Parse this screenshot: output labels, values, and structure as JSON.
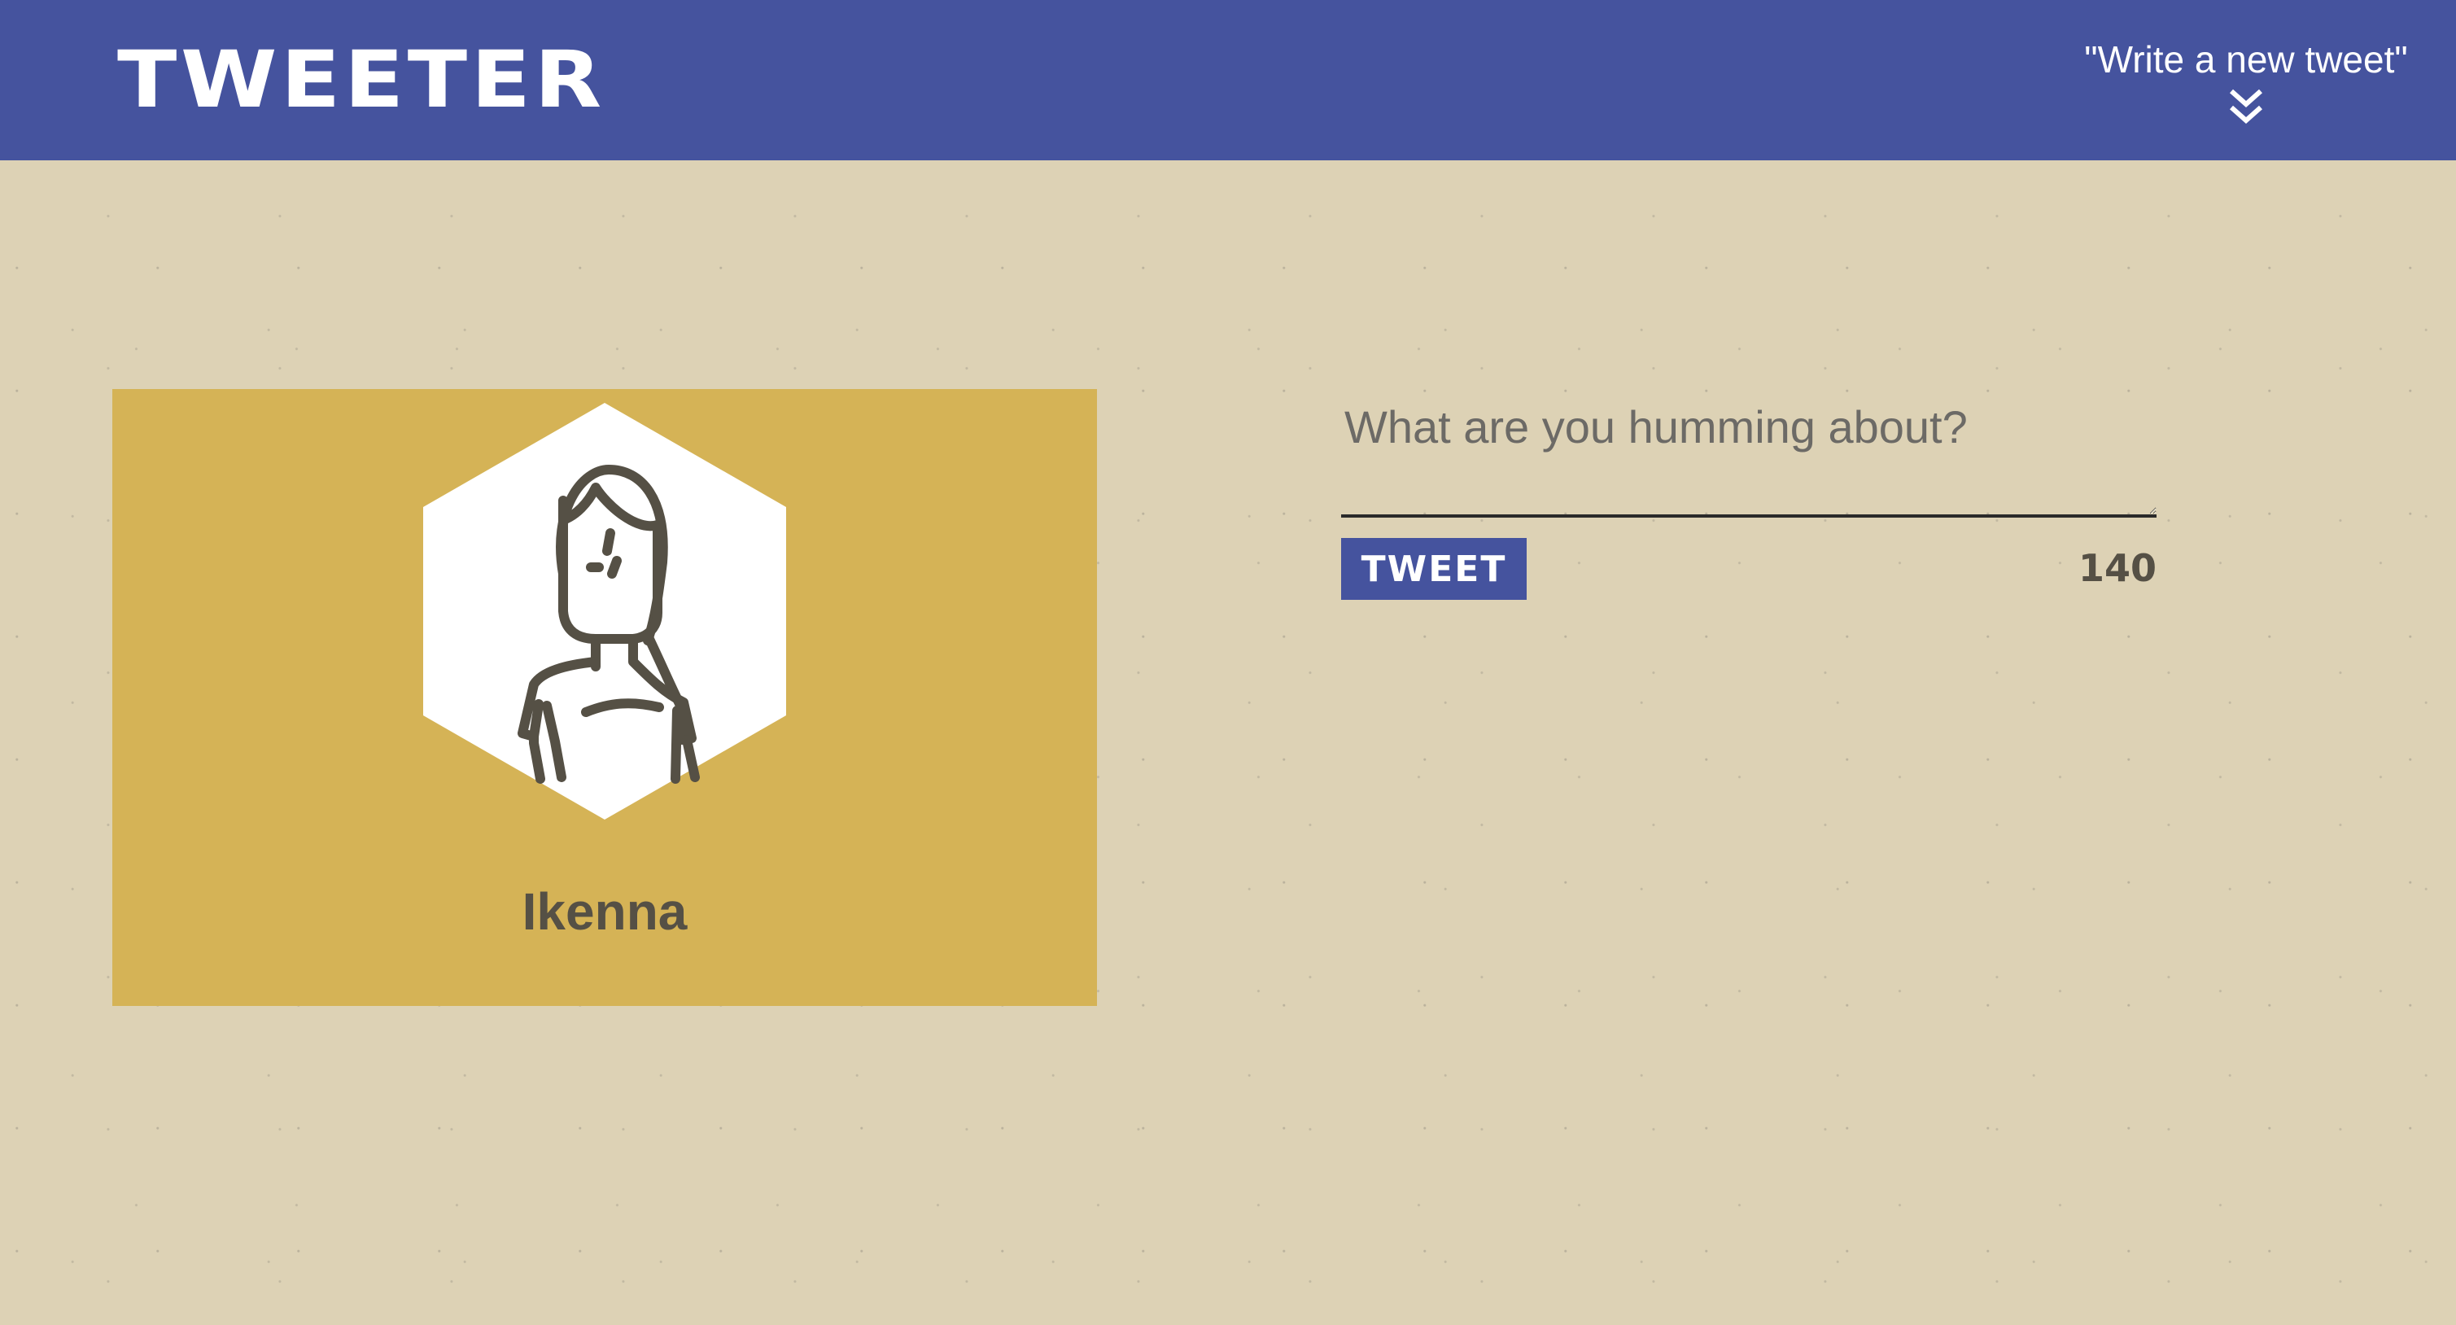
{
  "header": {
    "logo": "Tweeter",
    "compose_toggle_label": "\"Write a new tweet\"",
    "compose_toggle_icon": "double-chevron-down-icon"
  },
  "profile": {
    "avatar_icon": "user-avatar-icon",
    "name": "Ikenna"
  },
  "composer": {
    "placeholder": "What are you humming about?",
    "value": "",
    "submit_label": "Tweet",
    "char_count": "140"
  },
  "colors": {
    "header": "#45539e",
    "page_background": "#ddd2b5",
    "profile_card": "#d5b356",
    "text_dark": "#555045",
    "button": "#45539e"
  }
}
